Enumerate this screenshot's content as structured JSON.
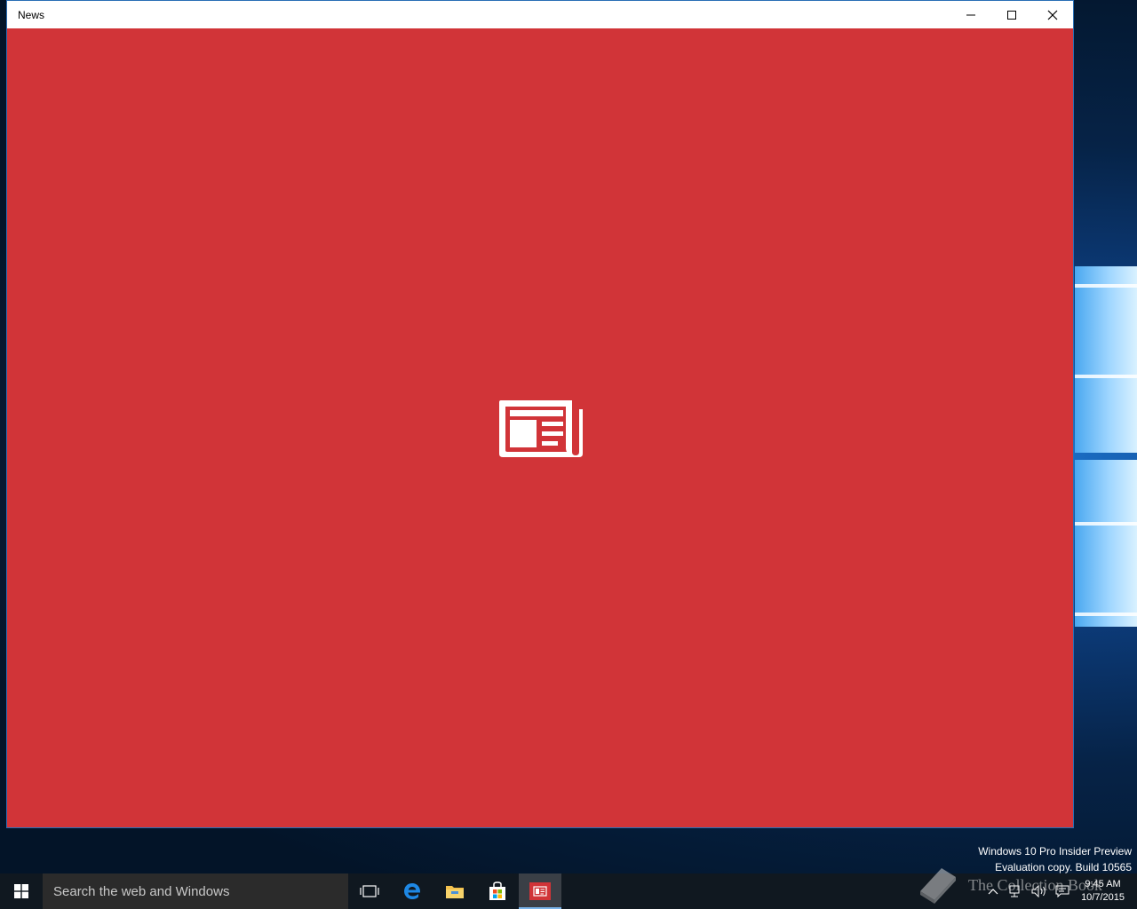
{
  "window": {
    "title": "News",
    "background_color": "#d13438"
  },
  "titlebar": {
    "minimize_icon": "minimize-icon",
    "maximize_icon": "maximize-icon",
    "close_icon": "close-icon"
  },
  "splash": {
    "icon": "newspaper-icon"
  },
  "watermark": {
    "line1": "Windows 10 Pro Insider Preview",
    "line2": "Evaluation copy. Build 10565"
  },
  "taskbar": {
    "search_placeholder": "Search the web and Windows",
    "icons": [
      "windows-start-icon",
      "task-view-icon",
      "edge-icon",
      "file-explorer-icon",
      "store-icon",
      "news-app-icon"
    ]
  },
  "tray": {
    "time": "9:45 AM",
    "date": "10/7/2015"
  },
  "overlay": {
    "text": "The Collection Book"
  }
}
